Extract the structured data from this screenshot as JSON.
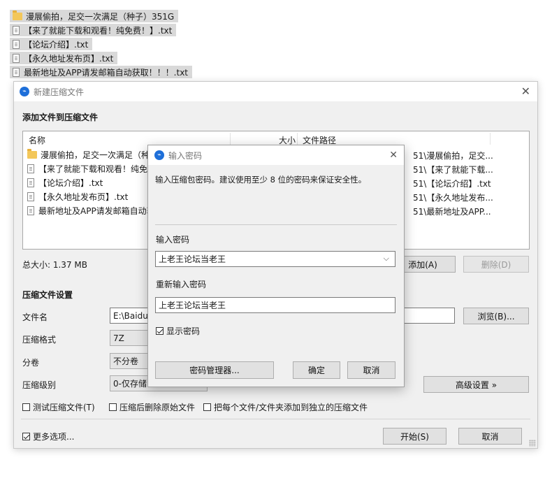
{
  "desktop_files": [
    {
      "icon": "folder-icon",
      "label": "漫展偷拍，足交一次满足（种子）351G"
    },
    {
      "icon": "text-file-icon",
      "label": "【来了就能下载和观看！纯免费！】.txt"
    },
    {
      "icon": "text-file-icon",
      "label": "【论坛介绍】.txt"
    },
    {
      "icon": "text-file-icon",
      "label": "【永久地址发布页】.txt"
    },
    {
      "icon": "text-file-icon",
      "label": "最新地址及APP请发邮箱自动获取！！！.txt"
    }
  ],
  "main_window": {
    "title": "新建压缩文件",
    "close": "✕",
    "add_section_title": "添加文件到压缩文件",
    "columns": {
      "name": "名称",
      "size": "大小",
      "path": "文件路径"
    },
    "rows": [
      {
        "name": "漫展偷拍，足交一次满足（种子）",
        "path": "51\\漫展偷拍，足交..."
      },
      {
        "name": "【来了就能下载和观看！纯免费",
        "path": "51\\【来了就能下载..."
      },
      {
        "name": "【论坛介绍】.txt",
        "path": "51\\【论坛介绍】.txt"
      },
      {
        "name": "【永久地址发布页】.txt",
        "path": "51\\【永久地址发布..."
      },
      {
        "name": "最新地址及APP请发邮箱自动获",
        "path": "51\\最新地址及APP..."
      }
    ],
    "total_size": "总大小: 1.37 MB",
    "add_button": "添加(A)",
    "delete_button": "删除(D)",
    "settings_title": "压缩文件设置",
    "filename_label": "文件名",
    "filename_value": "E:\\BaiduN",
    "browse_button": "浏览(B)...",
    "format_label": "压缩格式",
    "format_value": "7Z",
    "split_label": "分卷",
    "split_value": "不分卷",
    "level_label": "压缩级别",
    "level_value": "0-仅存储",
    "advanced_button": "高级设置 »",
    "checkbox_test": "测试压缩文件(T)",
    "checkbox_delete": "压缩后删除原始文件",
    "checkbox_separate": "把每个文件/文件夹添加到独立的压缩文件",
    "checkbox_more": "更多选项...",
    "start_button": "开始(S)",
    "cancel_button": "取消"
  },
  "password_dialog": {
    "title": "输入密码",
    "close": "✕",
    "hint": "输入压缩包密码。建议使用至少 8 位的密码来保证安全性。",
    "password_label": "输入密码",
    "password_value": "上老王论坛当老王",
    "confirm_label": "重新输入密码",
    "confirm_value": "上老王论坛当老王",
    "show_password_label": "显示密码",
    "show_password_checked": true,
    "manager_button": "密码管理器...",
    "ok_button": "确定",
    "cancel_button": "取消"
  }
}
